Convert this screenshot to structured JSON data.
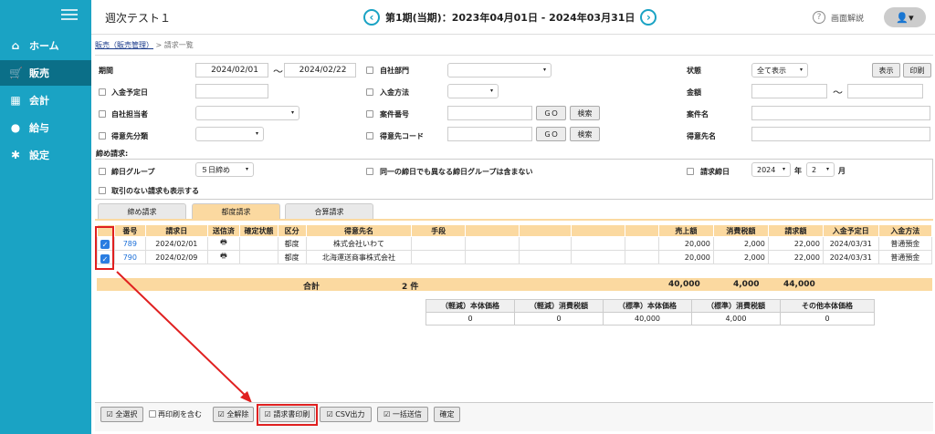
{
  "sidebar": {
    "items": [
      {
        "label": "ホーム",
        "icon": "home-icon"
      },
      {
        "label": "販売",
        "icon": "cart-icon"
      },
      {
        "label": "会計",
        "icon": "calculator-icon"
      },
      {
        "label": "給与",
        "icon": "moneybag-icon"
      },
      {
        "label": "設定",
        "icon": "gear-icon"
      }
    ]
  },
  "header": {
    "title": "週次テスト１",
    "period": "第1期(当期)：2023年04月01日 - 2024年03月31日",
    "help": "画面解説"
  },
  "breadcrumb": {
    "link": "販売（販売管理）",
    "sep": ">",
    "current": "請求一覧"
  },
  "filters": {
    "period_label": "期間",
    "period_from": "2024/02/01",
    "period_tilde": "〜",
    "period_to": "2024/02/22",
    "dept_label": "自社部門",
    "status_label": "状態",
    "status_value": "全て表示",
    "show_btn": "表示",
    "print_btn": "印刷",
    "due_label": "入金予定日",
    "paymethod_label": "入金方法",
    "amount_label": "金額",
    "amount_tilde": "〜",
    "staff_label": "自社担当者",
    "case_no_label": "案件番号",
    "go1": "ＧＯ",
    "search1": "検索",
    "case_name_label": "案件名",
    "cust_cat_label": "得意先分類",
    "cust_code_label": "得意先コード",
    "go2": "ＧＯ",
    "search2": "検索",
    "cust_name_label": "得意先名"
  },
  "closing": {
    "title": "締め請求:",
    "group_label": "締日グループ",
    "group_value": "５日締め",
    "ignore_label": "同一の締日でも異なる締日グループは含まない",
    "close_day_label": "請求締日",
    "year": "2024",
    "year_unit": "年",
    "month": "2",
    "month_unit": "月",
    "show_none_label": "取引のない請求も表示する"
  },
  "tabs": [
    "締め請求",
    "都度請求",
    "合算請求"
  ],
  "table": {
    "headers": [
      "番号",
      "請求日",
      "送信済",
      "確定状態",
      "区分",
      "得意先名",
      "手段",
      "売上額",
      "消費税額",
      "請求額",
      "入金予定日",
      "入金方法"
    ],
    "rows": [
      {
        "no": "789",
        "date": "2024/02/01",
        "sent": "🖶",
        "cat": "都度",
        "cust": "株式会社いわて",
        "sales": "20,000",
        "tax": "2,000",
        "amount": "22,000",
        "due": "2024/03/31",
        "method": "普通預金"
      },
      {
        "no": "790",
        "date": "2024/02/09",
        "sent": "🖶",
        "cat": "都度",
        "cust": "北海運送商事株式会社",
        "sales": "20,000",
        "tax": "2,000",
        "amount": "22,000",
        "due": "2024/03/31",
        "method": "普通預金"
      }
    ],
    "total_label": "合計",
    "total_count": "2 件",
    "total_sales": "40,000",
    "total_tax": "4,000",
    "total_amount": "44,000"
  },
  "breakdown": {
    "headers": [
      "（軽減）本体価格",
      "（軽減）消費税額",
      "（標準）本体価格",
      "（標準）消費税額",
      "その他本体価格"
    ],
    "values": [
      "0",
      "0",
      "40,000",
      "4,000",
      "0"
    ]
  },
  "footer": {
    "select_all": "全選択",
    "reprint": "再印刷を含む",
    "deselect_all": "全解除",
    "print_invoice": "請求書印刷",
    "csv": "CSV出力",
    "bulk_send": "一括送信",
    "confirm": "確定"
  },
  "colors": {
    "sidebar": "#1aa3c4",
    "sidebar_active": "#0b6f88",
    "table_header": "#fbd9a0",
    "highlight": "#e02020"
  }
}
